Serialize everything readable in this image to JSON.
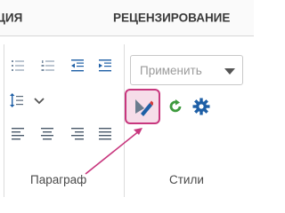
{
  "tabs": {
    "partial_left": "ЦИЯ",
    "review": "РЕЦЕНЗИРОВАНИЕ"
  },
  "paragraph_group": {
    "label": "Параграф",
    "icons": [
      "bulleted-list-icon",
      "numbered-list-icon",
      "decrease-indent-icon",
      "increase-indent-icon",
      "line-spacing-icon",
      "chevron-down-icon",
      "align-left-icon",
      "align-center-icon",
      "align-right-icon",
      "align-justify-icon"
    ]
  },
  "styles_group": {
    "label": "Стили",
    "apply_placeholder": "Применить",
    "icons": [
      "format-painter-icon",
      "refresh-style-icon",
      "style-settings-icon"
    ]
  },
  "colors": {
    "accent": "#c8377e",
    "highlight_bg": "#f6dde9",
    "icon_blue": "#1e5fa6",
    "icon_green": "#3d9a3d",
    "icon_gray": "#7a8ea3"
  }
}
